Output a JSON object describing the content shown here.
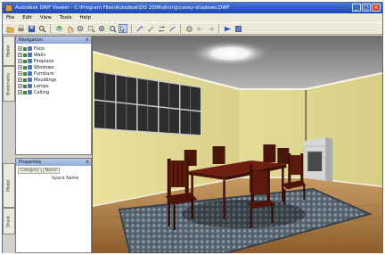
{
  "window": {
    "title": "Autodesk DWF Viewer - C:\\Program Files\\Autodesk\\DS 2006\\dining\\casey-shadows.DWF"
  },
  "menu": [
    "File",
    "Edit",
    "View",
    "Tools",
    "Help"
  ],
  "toolbar": {
    "buttons": [
      "open-icon",
      "print-icon",
      "save-icon",
      "search-icon",
      "layers-icon",
      "pan-icon",
      "zoom-icon",
      "zoom-rect-icon",
      "zoom-in-icon",
      "zoom-out-icon",
      "select-icon",
      "measure-icon",
      "markup-icon",
      "orbit-icon",
      "walk-icon",
      "fit-icon",
      "prev-icon",
      "next-icon",
      "flag-icon",
      "settings-icon"
    ]
  },
  "navigation": {
    "header": "Navigation",
    "side_tabs": [
      "Model",
      "Bookmarks"
    ],
    "items": [
      {
        "label": "Floor"
      },
      {
        "label": "Walls"
      },
      {
        "label": "Fireplace"
      },
      {
        "label": "Windows"
      },
      {
        "label": "Furniture"
      },
      {
        "label": "Mouldings"
      },
      {
        "label": "Lamps"
      },
      {
        "label": "Ceiling"
      }
    ]
  },
  "properties": {
    "header": "Properties",
    "side_tabs": [
      "Model",
      "Sheet"
    ],
    "tabs": [
      "Category",
      "Name"
    ],
    "rows": [
      {
        "key": "",
        "value": "Space Name"
      }
    ]
  },
  "colors": {
    "title_bar": "#2a58c2",
    "wall": "#e6df9a",
    "floor": "#a9773f",
    "rug": "#5b6a7a",
    "table": "#6b1e10"
  }
}
